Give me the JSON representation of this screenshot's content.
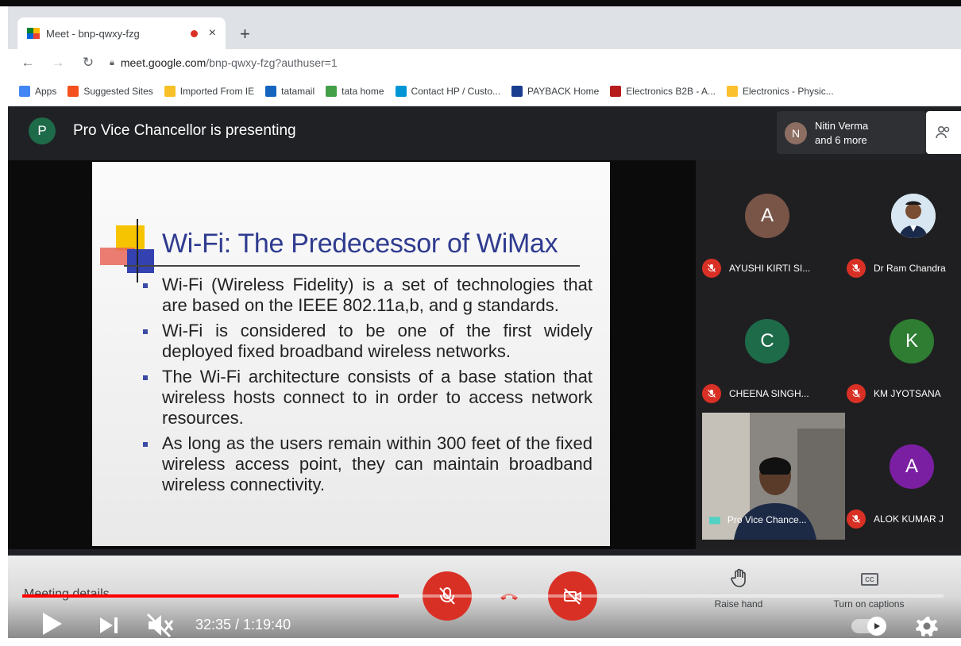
{
  "browser": {
    "tab_title": "Meet - bnp-qwxy-fzg",
    "tab_close": "×",
    "new_tab": "+",
    "url_host": "meet.google.com",
    "url_path": "/bnp-qwxy-fzg?authuser=1",
    "bookmarks": [
      {
        "label": "Apps",
        "color": "#4285f4"
      },
      {
        "label": "Suggested Sites",
        "color": "#f4511e"
      },
      {
        "label": "Imported From IE",
        "color": "#f6c026"
      },
      {
        "label": "tatamail",
        "color": "#1565c0"
      },
      {
        "label": "tata home",
        "color": "#43a047"
      },
      {
        "label": "Contact HP / Custo...",
        "color": "#0096d6"
      },
      {
        "label": "PAYBACK Home",
        "color": "#1a3d8f"
      },
      {
        "label": "Electronics B2B - A...",
        "color": "#b71c1c"
      },
      {
        "label": "Electronics - Physic...",
        "color": "#fbc02d"
      }
    ]
  },
  "meet": {
    "presenter_initial": "P",
    "presenting_text": "Pro Vice Chancellor is presenting",
    "people_initial": "N",
    "people_line1": "Nitin Verma",
    "people_line2": "and 6 more"
  },
  "slide": {
    "title": "Wi-Fi: The Predecessor of WiMax",
    "bullets": [
      "Wi-Fi (Wireless Fidelity) is a set of technologies that are based on the IEEE 802.11a,b, and g standards.",
      "Wi-Fi is considered to be one of the first widely deployed fixed broadband wireless networks.",
      "The Wi-Fi architecture consists of a base station that wireless hosts connect to in order to access network resources.",
      "As long as the users remain within 300 feet of the fixed wireless access point, they can maintain broadband wireless connectivity."
    ]
  },
  "participants": [
    {
      "initial": "A",
      "name": "AYUSHI KIRTI SI...",
      "color": "#795548"
    },
    {
      "initial": "",
      "name": "Dr Ram Chandra",
      "color": "#d8e6f2"
    },
    {
      "initial": "C",
      "name": "CHEENA SINGH...",
      "color": "#1e6b4a"
    },
    {
      "initial": "K",
      "name": "KM JYOTSANA",
      "color": "#2e7d32"
    },
    {
      "initial": "A",
      "name": "ALOK KUMAR J",
      "color": "#7b1fa2"
    }
  ],
  "selfview": {
    "name": "Pro Vice Chance..."
  },
  "controls": {
    "meeting_details": "Meeting details",
    "raise_hand": "Raise hand",
    "captions": "Turn on captions",
    "captions_badge": "CC"
  },
  "player": {
    "time": "32:35 / 1:19:40",
    "progress": 0.409
  }
}
